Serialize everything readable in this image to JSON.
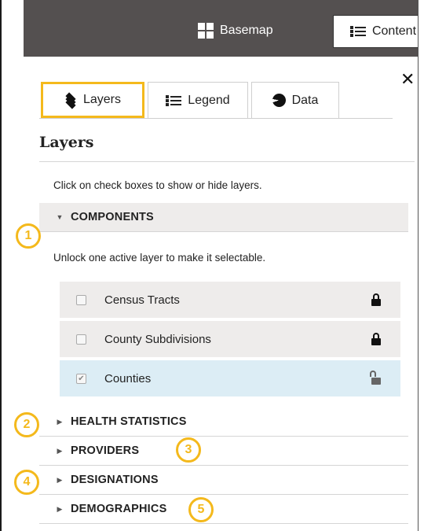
{
  "toolbar": {
    "basemap_label": "Basemap",
    "content_label": "Content"
  },
  "tabs": [
    {
      "label": "Layers",
      "icon": "layers-icon",
      "selected": true
    },
    {
      "label": "Legend",
      "icon": "list-icon",
      "selected": false
    },
    {
      "label": "Data",
      "icon": "pie-chart-icon",
      "selected": false
    }
  ],
  "panel": {
    "close_glyph": "✕",
    "title": "Layers",
    "instructions": "Click on check boxes to show or hide layers."
  },
  "groups": [
    {
      "label": "COMPONENTS",
      "expanded": true
    },
    {
      "label": "HEALTH STATISTICS",
      "expanded": false
    },
    {
      "label": "PROVIDERS",
      "expanded": false
    },
    {
      "label": "DESIGNATIONS",
      "expanded": false
    },
    {
      "label": "DEMOGRAPHICS",
      "expanded": false
    }
  ],
  "components": {
    "hint": "Unlock one active layer to make it selectable.",
    "layers": [
      {
        "name": "Census Tracts",
        "checked": false,
        "locked": true
      },
      {
        "name": "County Subdivisions",
        "checked": false,
        "locked": true
      },
      {
        "name": "Counties",
        "checked": true,
        "locked": false
      }
    ]
  },
  "callouts": [
    "1",
    "2",
    "3",
    "4",
    "5"
  ],
  "colors": {
    "accent": "#f4b91c",
    "toolbar_bg": "#545050",
    "active_row_bg": "#dcedf5",
    "row_bg": "#eeeceb"
  }
}
